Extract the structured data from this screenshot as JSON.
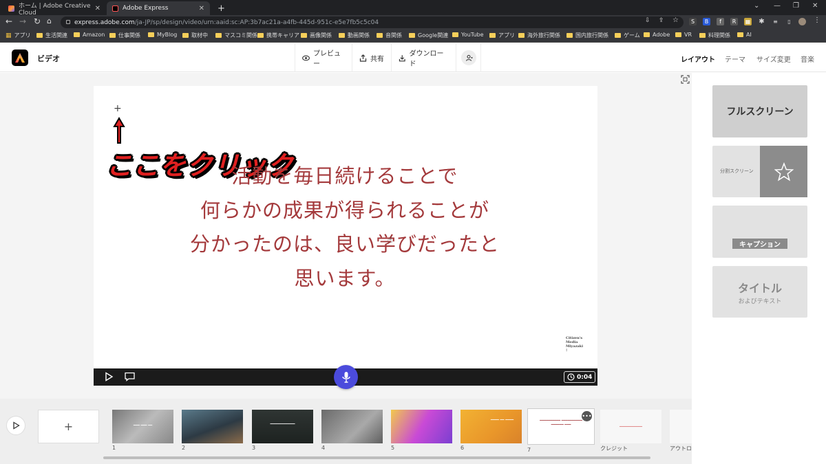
{
  "browser": {
    "tabs": [
      {
        "title": "ホーム | Adobe Creative Cloud"
      },
      {
        "title": "Adobe Express"
      }
    ],
    "new_tab": "+",
    "url_host": "express.adobe.com",
    "url_path": "/ja-JP/sp/design/video/urn:aaid:sc:AP:3b7ac21a-a4fb-445d-951c-e5e7fb5c5c04",
    "bookmarks": [
      "アプリ",
      "生活関連",
      "Amazon",
      "仕事関係",
      "MyBlog",
      "取材中",
      "マスコミ関係",
      "携帯キャリア",
      "画像関係",
      "動画関係",
      "音関係",
      "Google関連",
      "YouTube",
      "アプリ",
      "海外旅行関係",
      "国内旅行関係",
      "ゲーム",
      "Adobe",
      "VR",
      "料理関係",
      "AI"
    ]
  },
  "header": {
    "doc_title": "ビデオ",
    "preview": "プレビュー",
    "share": "共有",
    "download": "ダウンロード",
    "right_tabs": [
      "レイアウト",
      "テーマ",
      "サイズ変更",
      "音楽"
    ]
  },
  "canvas": {
    "overlay": "ここをクリック",
    "caption_lines": [
      "活動を毎日続けることで",
      "何らかの成果が得られることが",
      "分かったのは、良い学びだったと",
      "思います。"
    ],
    "watermark": [
      "Citizen's",
      "Media",
      "Miyazaki",
      "!"
    ],
    "duration": "0:04",
    "plus": "+"
  },
  "layouts": {
    "full": "フルスクリーン",
    "split": "分割スクリーン",
    "caption": "キャプション",
    "title_main": "タイトル",
    "title_sub": "およびテキスト"
  },
  "timeline": {
    "add": "+",
    "scene_numbers": [
      "1",
      "2",
      "3",
      "4",
      "5",
      "6",
      "7"
    ],
    "credit": "クレジット",
    "outro": "アウトロ"
  },
  "colors": {
    "caption": "#a43a3c",
    "overlay": "#e02020",
    "mic": "#4b4bdc",
    "active_tab": "#35363a"
  }
}
